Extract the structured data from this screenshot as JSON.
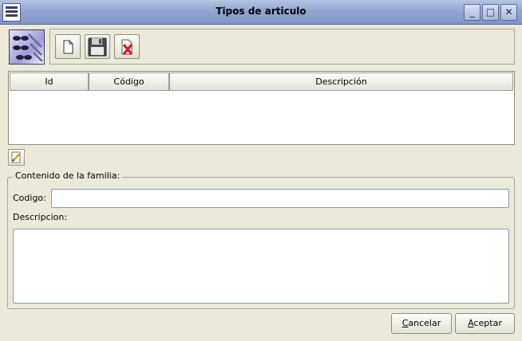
{
  "window": {
    "title": "Tipos de articulo",
    "controls": [
      "_",
      "□",
      "✕"
    ]
  },
  "toolbar": {
    "logo_icon": "glasses-tools-icon",
    "buttons": [
      "new-document-icon",
      "save-floppy-icon",
      "delete-document-icon"
    ]
  },
  "table": {
    "columns": [
      "Id",
      "Código",
      "Descripción"
    ],
    "rows": []
  },
  "form": {
    "group_title": "Contenido de la familia:",
    "codigo_label": "Codigo:",
    "codigo_value": "",
    "descripcion_label": "Descripcion:",
    "descripcion_value": ""
  },
  "buttons": {
    "cancel_first": "C",
    "cancel_rest": "ancelar",
    "accept_first": "A",
    "accept_rest": "ceptar"
  }
}
